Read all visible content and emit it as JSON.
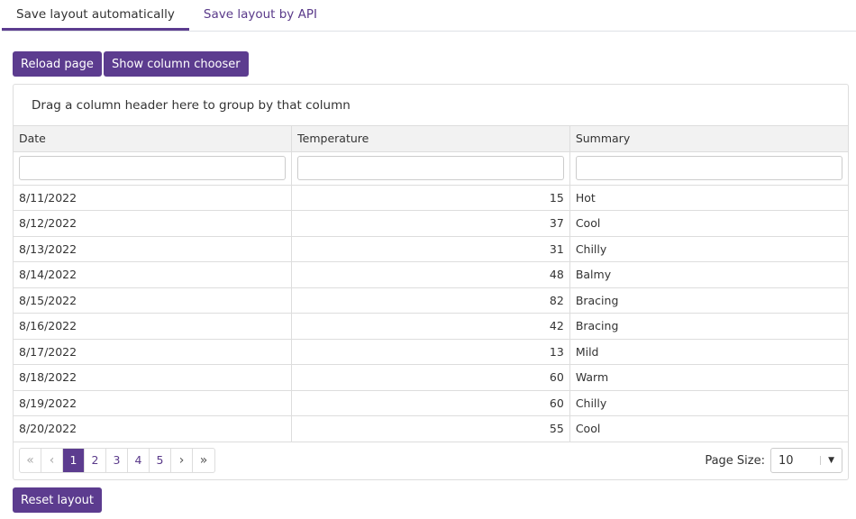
{
  "tabs": [
    {
      "label": "Save layout automatically",
      "active": true
    },
    {
      "label": "Save layout by API",
      "active": false
    }
  ],
  "toolbar": {
    "reload": "Reload page",
    "chooser": "Show column chooser"
  },
  "grid": {
    "group_panel": "Drag a column header here to group by that column",
    "columns": [
      "Date",
      "Temperature",
      "Summary"
    ],
    "rows": [
      [
        "8/11/2022",
        "15",
        "Hot"
      ],
      [
        "8/12/2022",
        "37",
        "Cool"
      ],
      [
        "8/13/2022",
        "31",
        "Chilly"
      ],
      [
        "8/14/2022",
        "48",
        "Balmy"
      ],
      [
        "8/15/2022",
        "82",
        "Bracing"
      ],
      [
        "8/16/2022",
        "42",
        "Bracing"
      ],
      [
        "8/17/2022",
        "13",
        "Mild"
      ],
      [
        "8/18/2022",
        "60",
        "Warm"
      ],
      [
        "8/19/2022",
        "60",
        "Chilly"
      ],
      [
        "8/20/2022",
        "55",
        "Cool"
      ]
    ],
    "pager": {
      "first": "«",
      "prev": "‹",
      "pages": [
        "1",
        "2",
        "3",
        "4",
        "5"
      ],
      "current": "1",
      "next": "›",
      "last": "»"
    },
    "page_size_label": "Page Size:",
    "page_size": "10"
  },
  "reset": "Reset layout",
  "colors": {
    "accent": "#5c3c8f"
  }
}
